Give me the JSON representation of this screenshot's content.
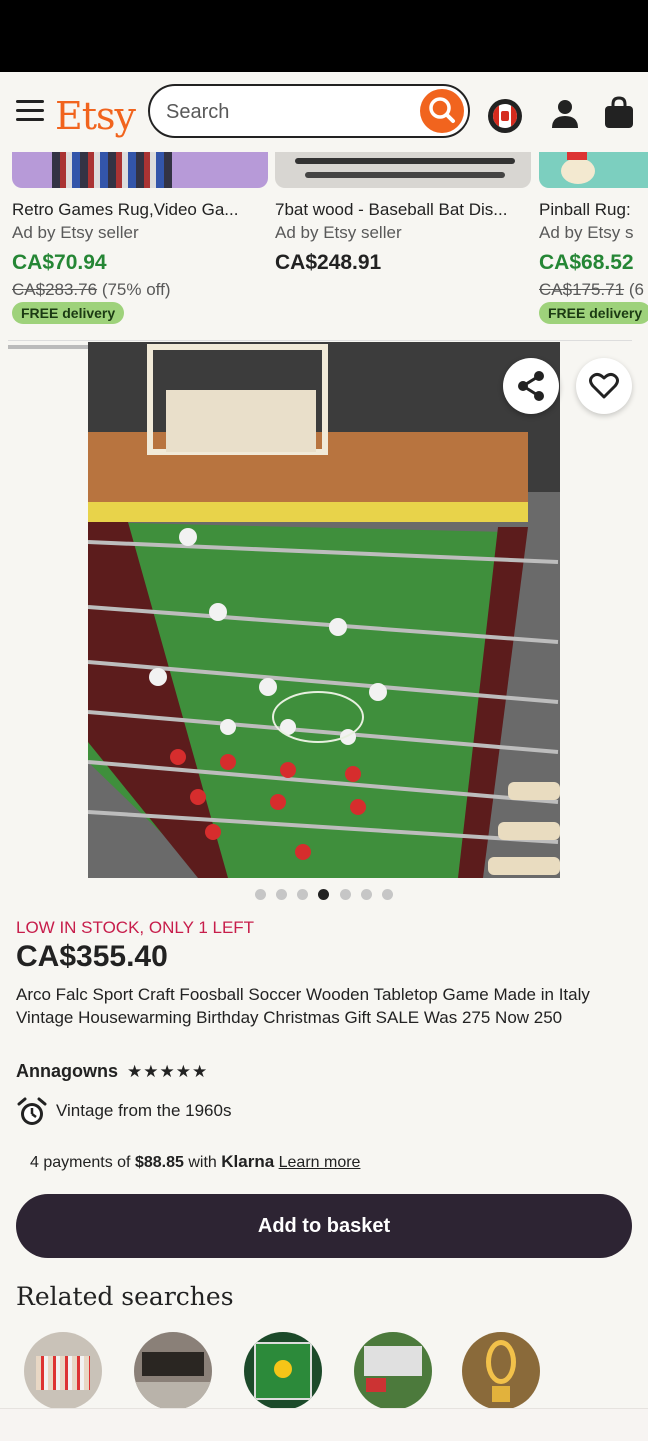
{
  "header": {
    "logo": "Etsy",
    "search_placeholder": "Search"
  },
  "ads": [
    {
      "title": "Retro Games Rug,Video Ga...",
      "sub": "Ad by Etsy seller",
      "price": "CA$70.94",
      "orig": "CA$283.76",
      "discount": "(75% off)",
      "free": "FREE delivery",
      "price_color": "#258635"
    },
    {
      "title": "7bat wood - Baseball Bat Dis...",
      "sub": "Ad by Etsy seller",
      "price": "CA$248.91",
      "orig": "",
      "discount": "",
      "free": "",
      "price_color": "#222222"
    },
    {
      "title": "Pinball Rug:",
      "sub": "Ad by Etsy s",
      "price": "CA$68.52",
      "orig": "CA$175.71",
      "discount": "(6",
      "free": "FREE delivery",
      "price_color": "#258635"
    }
  ],
  "carousel": {
    "count": 7,
    "active": 3
  },
  "product": {
    "stock": "LOW IN STOCK, ONLY 1 LEFT",
    "price": "CA$355.40",
    "title": "Arco Falc Sport Craft Foosball Soccer Wooden Tabletop Game Made in Italy Vintage Housewarming Birthday Christmas Gift SALE Was 275 Now 250",
    "shop": "Annagowns",
    "rating": 5,
    "vintage": "Vintage from the 1960s",
    "klarna_prefix": "4 payments of",
    "klarna_amount": "$88.85",
    "klarna_with": "with",
    "klarna_brand": "Klarna",
    "klarna_learn": "Learn more",
    "basket": "Add to basket"
  },
  "related": {
    "title": "Related searches",
    "icons": [
      "foosball-players-icon",
      "foosball-table-icon",
      "soccer-board-icon",
      "soccer-goal-icon",
      "trophy-icon"
    ]
  },
  "colors": {
    "accent": "#f1641e",
    "stock": "#c71d4b",
    "button": "#2d2433",
    "free_bg": "#9ed27b"
  }
}
